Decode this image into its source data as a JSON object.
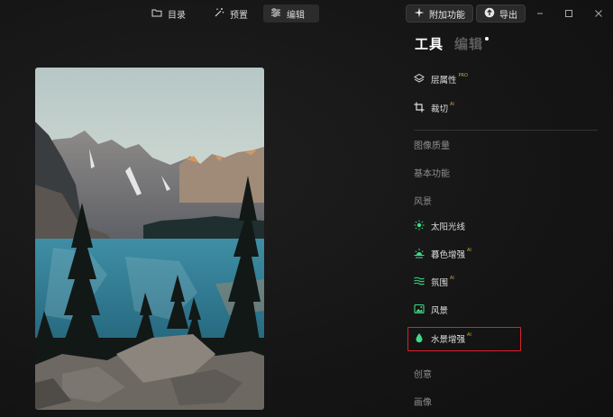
{
  "toolbar": {
    "tabs": [
      {
        "label": "目录",
        "icon": "folder-icon"
      },
      {
        "label": "预置",
        "icon": "magic-wand-icon"
      },
      {
        "label": "编辑",
        "icon": "sliders-icon"
      }
    ],
    "addon_label": "附加功能",
    "export_label": "导出",
    "window_controls": [
      "minimize",
      "maximize",
      "close"
    ]
  },
  "photo": {
    "description_icon": "mountain-lake-photo"
  },
  "panel": {
    "tools_title": "工具",
    "edit_title": "编辑",
    "top_tools": [
      {
        "label": "层属性",
        "badge": "PRO",
        "icon": "layers-icon"
      },
      {
        "label": "裁切",
        "badge": "AI",
        "icon": "crop-icon"
      }
    ],
    "categories": {
      "image_quality": "图像质量",
      "basic": "基本功能",
      "landscape": "风景",
      "creative": "创意",
      "portrait": "画像"
    },
    "landscape_tools": [
      {
        "label": "太阳光线",
        "badge": "",
        "icon": "sun-rays-icon"
      },
      {
        "label": "暮色增强",
        "badge": "AI",
        "icon": "sunset-icon"
      },
      {
        "label": "氛围",
        "badge": "AI",
        "icon": "waves-icon"
      },
      {
        "label": "风景",
        "badge": "",
        "icon": "image-icon"
      },
      {
        "label": "水景增强",
        "badge": "AI",
        "icon": "water-drop-icon"
      }
    ]
  },
  "colors": {
    "accent_green": "#3ddc84",
    "highlight_red": "#d9232a",
    "badge_gold": "#c9a64a"
  }
}
